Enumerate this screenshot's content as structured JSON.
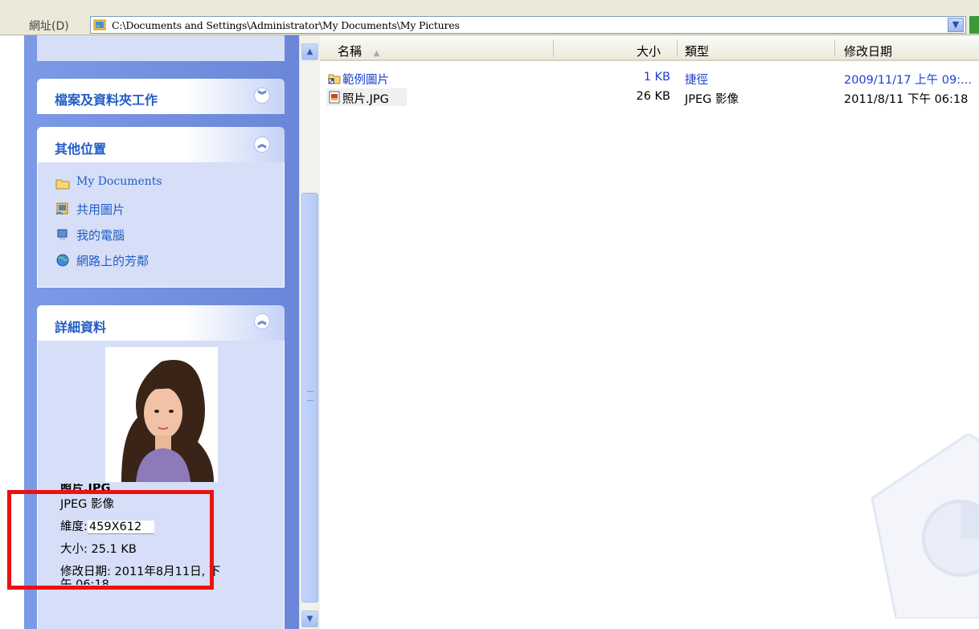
{
  "address_bar": {
    "label": "網址(D)",
    "path": "C:\\Documents and Settings\\Administrator\\My Documents\\My Pictures"
  },
  "task_pane": {
    "file_tasks": {
      "title": "檔案及資料夾工作"
    },
    "other_places": {
      "title": "其他位置",
      "links": [
        {
          "label": "My Documents",
          "icon": "folder-icon"
        },
        {
          "label": "共用圖片",
          "icon": "shared-pictures-icon"
        },
        {
          "label": "我的電腦",
          "icon": "my-computer-icon"
        },
        {
          "label": "網路上的芳鄰",
          "icon": "network-places-icon"
        }
      ]
    },
    "details": {
      "title": "詳細資料",
      "file_name": "照片.JPG",
      "file_type": "JPEG 影像",
      "dimensions_label": "維度:",
      "dimensions_value": "459X612",
      "size_line": "大小: 25.1 KB",
      "modified_line_1": "修改日期: 2011年8月11日, 下",
      "modified_line_2": "午 06:18"
    }
  },
  "file_list": {
    "headers": {
      "name": "名稱",
      "size": "大小",
      "type": "類型",
      "modified": "修改日期"
    },
    "sort_indicator": "▲",
    "rows": [
      {
        "name": "範例圖片",
        "size": "1 KB",
        "type": "捷徑",
        "modified": "2009/11/17 上午 09:...",
        "icon": "shortcut-folder-icon"
      },
      {
        "name": "照片.JPG",
        "size": "26 KB",
        "type": "JPEG 影像",
        "modified": "2011/8/11 下午 06:18",
        "icon": "jpeg-file-icon"
      }
    ]
  },
  "colors": {
    "task_pane_bg": "#7b9ae6",
    "link_blue": "#215dc6",
    "highlight_red": "#ee1111"
  }
}
